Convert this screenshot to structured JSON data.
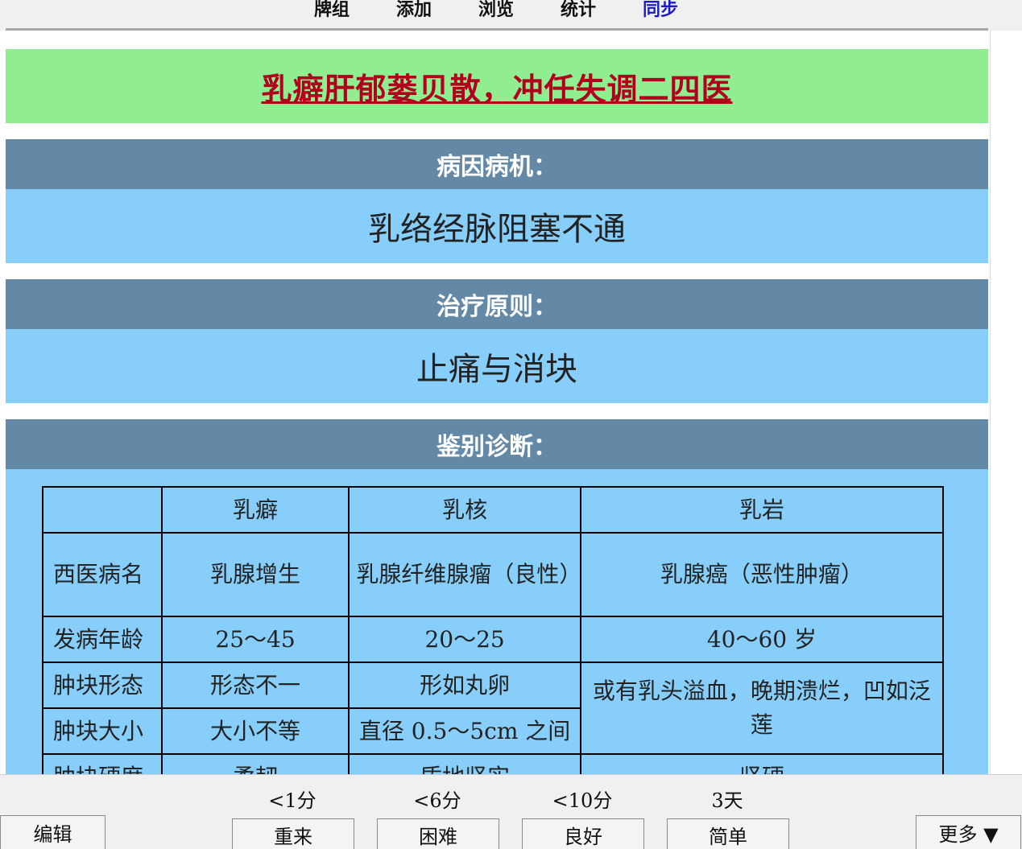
{
  "nav": {
    "items": [
      "牌组",
      "添加",
      "浏览",
      "统计",
      "同步"
    ],
    "active": "同步"
  },
  "card": {
    "title": "乳癖肝郁蒌贝散，冲任失调二四医",
    "sections": [
      {
        "heading": "病因病机：",
        "content": "乳络经脉阻塞不通"
      },
      {
        "heading": "治疗原则：",
        "content": "止痛与消块"
      },
      {
        "heading": "鉴别诊断："
      }
    ],
    "table": {
      "headers": [
        "",
        "乳癖",
        "乳核",
        "乳岩"
      ],
      "rows": {
        "western": {
          "label": "西医病名",
          "c1": "乳腺增生",
          "c2": "乳腺纤维腺瘤（良性）",
          "c3": "乳腺癌（恶性肿瘤）"
        },
        "age": {
          "label": "发病年龄",
          "c1": "25～45",
          "c2": "20～25",
          "c3": "40～60 岁"
        },
        "shape": {
          "label": "肿块形态",
          "c1": "形态不一",
          "c2": "形如丸卵",
          "c3": "或有乳头溢血，晚期溃烂，凹如泛莲"
        },
        "size": {
          "label": "肿块大小",
          "c1": "大小不等",
          "c2": "直径 0.5～5cm 之间"
        },
        "hardness": {
          "label": "肿块硬度",
          "c1": "柔韧",
          "c2": "质地坚实",
          "c3": "坚硬"
        }
      }
    }
  },
  "review": {
    "edit_label": "编辑",
    "more_label": "更多 ▼",
    "intervals": [
      "<1分",
      "<6分",
      "<10分",
      "3天"
    ],
    "buttons": [
      "重来",
      "困难",
      "良好",
      "简单"
    ]
  },
  "colors": {
    "title_bg": "#90ee90",
    "title_text": "#b0001e",
    "section_head_bg": "#6489a6",
    "section_body_bg": "#87cefa",
    "nav_active": "#1a1acc"
  }
}
